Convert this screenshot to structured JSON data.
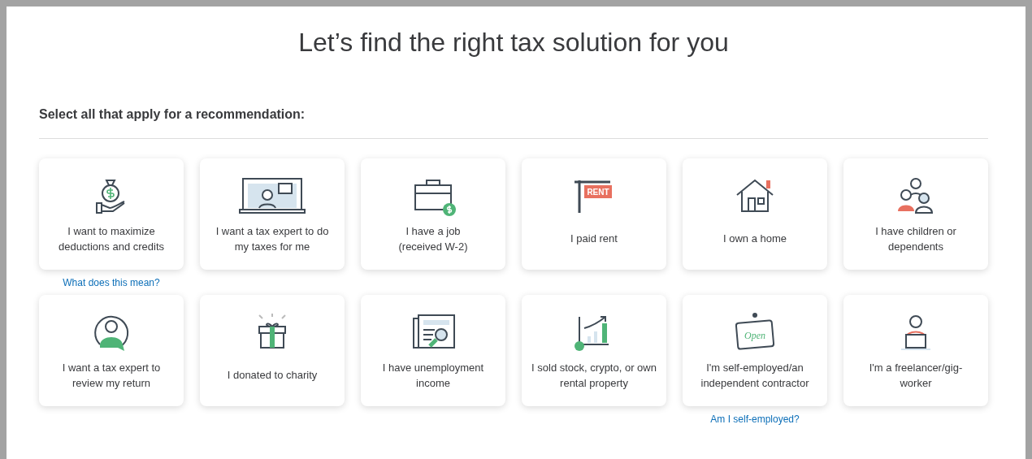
{
  "title": "Let’s find the right tax solution for you",
  "subtitle": "Select all that apply for a recommendation:",
  "options": [
    {
      "kind": "money-bag",
      "label": "I want to maximize deductions and credits",
      "selected": false,
      "link": "What does this mean?"
    },
    {
      "kind": "laptop-expert",
      "label": "I want a tax expert to do my taxes for me",
      "selected": false
    },
    {
      "kind": "briefcase",
      "label": "I have a job\n(received W-2)",
      "selected": false
    },
    {
      "kind": "rent-sign",
      "label": "I paid rent",
      "selected": false,
      "sign_text": "RENT"
    },
    {
      "kind": "house",
      "label": "I own a home",
      "selected": false
    },
    {
      "kind": "family",
      "label": "I have children or dependents",
      "selected": false
    },
    {
      "kind": "expert-chat",
      "label": "I want a tax expert to review my return",
      "selected": false
    },
    {
      "kind": "gift",
      "label": "I donated to charity",
      "selected": false
    },
    {
      "kind": "newspaper",
      "label": "I have unemployment income",
      "selected": false
    },
    {
      "kind": "stock-chart",
      "label": "I sold stock, crypto, or own rental property",
      "selected": false
    },
    {
      "kind": "open-sign",
      "label": "I'm self-employed/an independent contractor",
      "selected": false,
      "sign_text": "Open",
      "link": "Am I self-employed?"
    },
    {
      "kind": "freelancer",
      "label": "I'm a freelancer/gig-\nworker",
      "selected": false
    }
  ]
}
